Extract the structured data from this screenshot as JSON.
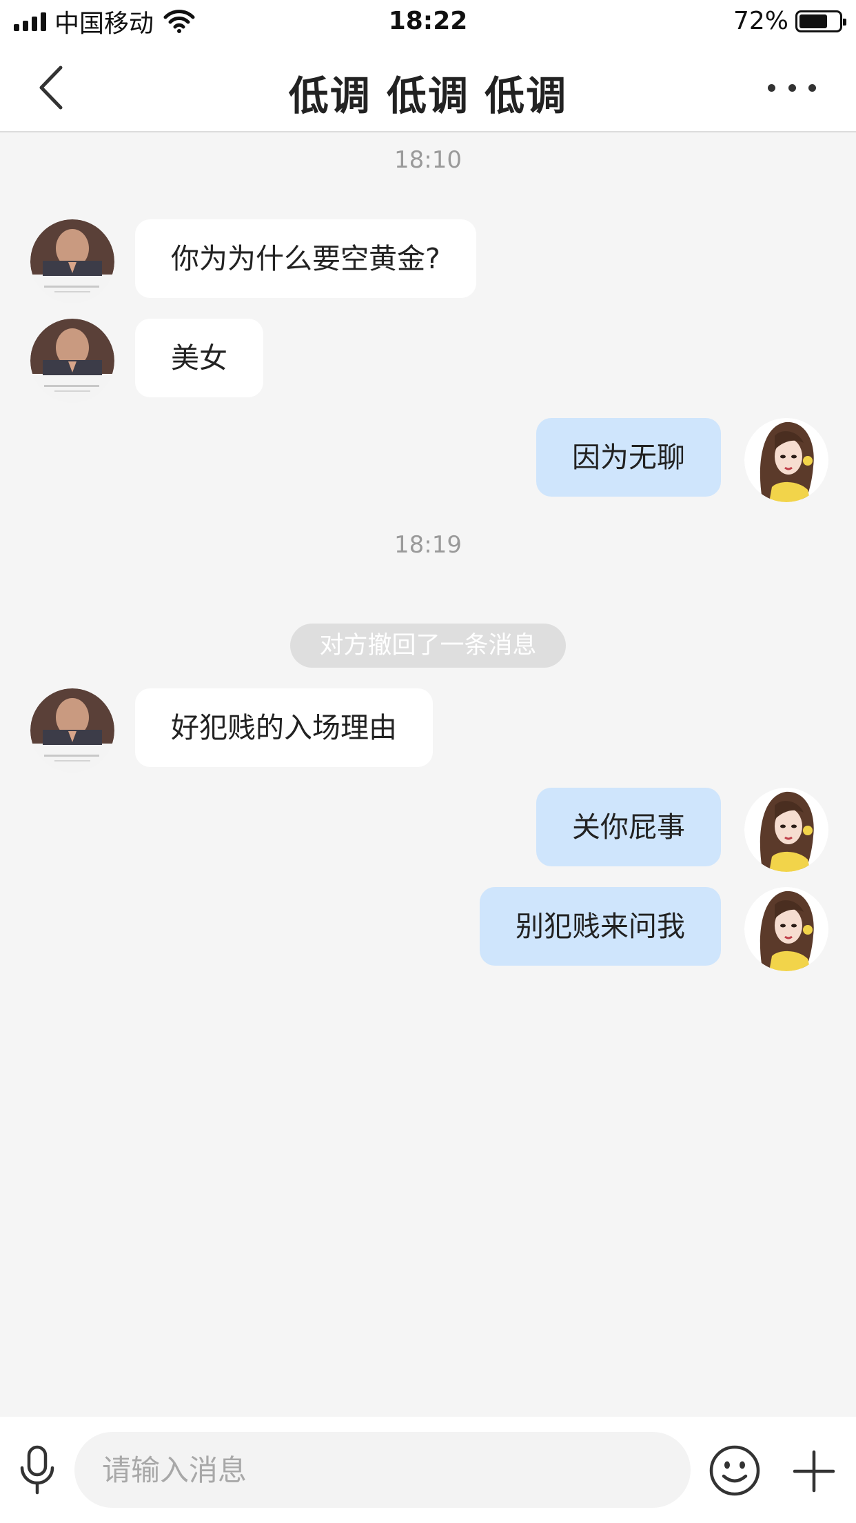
{
  "status_bar": {
    "carrier": "中国移动",
    "time": "18:22",
    "battery": "72%",
    "battery_level": 0.72
  },
  "nav": {
    "title": "低调 低调 低调"
  },
  "chat": {
    "timestamp_1": "18:10",
    "timestamp_2": "18:19",
    "recall_notice": "对方撤回了一条消息",
    "messages": [
      {
        "side": "in",
        "text": "你为为什么要空黄金?"
      },
      {
        "side": "in",
        "text": "美女"
      },
      {
        "side": "out",
        "text": "因为无聊"
      },
      {
        "side": "in",
        "text": "好犯贱的入场理由"
      },
      {
        "side": "out",
        "text": "关你屁事"
      },
      {
        "side": "out",
        "text": "别犯贱来问我"
      }
    ]
  },
  "input": {
    "placeholder": "请输入消息"
  },
  "icons": {
    "back": "chevron-left-icon",
    "more": "more-dots-icon",
    "mic": "microphone-icon",
    "emoji": "smiley-icon",
    "plus": "plus-icon"
  }
}
